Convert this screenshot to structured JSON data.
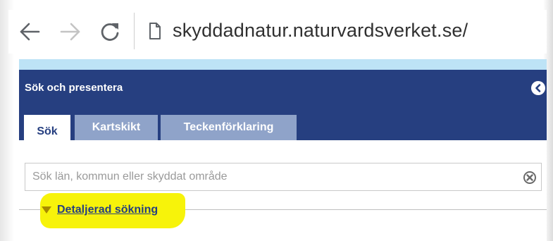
{
  "browser": {
    "url": "skyddadnatur.naturvardsverket.se/",
    "back_icon": "arrow-left",
    "forward_icon": "arrow-right",
    "reload_icon": "reload",
    "page_icon": "document"
  },
  "panel": {
    "title": "Sök och presentera",
    "collapse_icon": "chevron-left-circle",
    "colors": {
      "header": "#263f80",
      "strip": "#bde3f6",
      "inactive_tab": "#8fa3c9",
      "highlight": "#f7f30a"
    }
  },
  "tabs": [
    {
      "label": "Sök",
      "active": true
    },
    {
      "label": "Kartskikt",
      "active": false
    },
    {
      "label": "Teckenförklaring",
      "active": false
    }
  ],
  "search": {
    "placeholder": "Sök län, kommun eller skyddat område",
    "value": "",
    "clear_icon": "clear-circle-x"
  },
  "detail": {
    "label": "Detaljerad sökning",
    "toggle_icon": "triangle-down"
  }
}
